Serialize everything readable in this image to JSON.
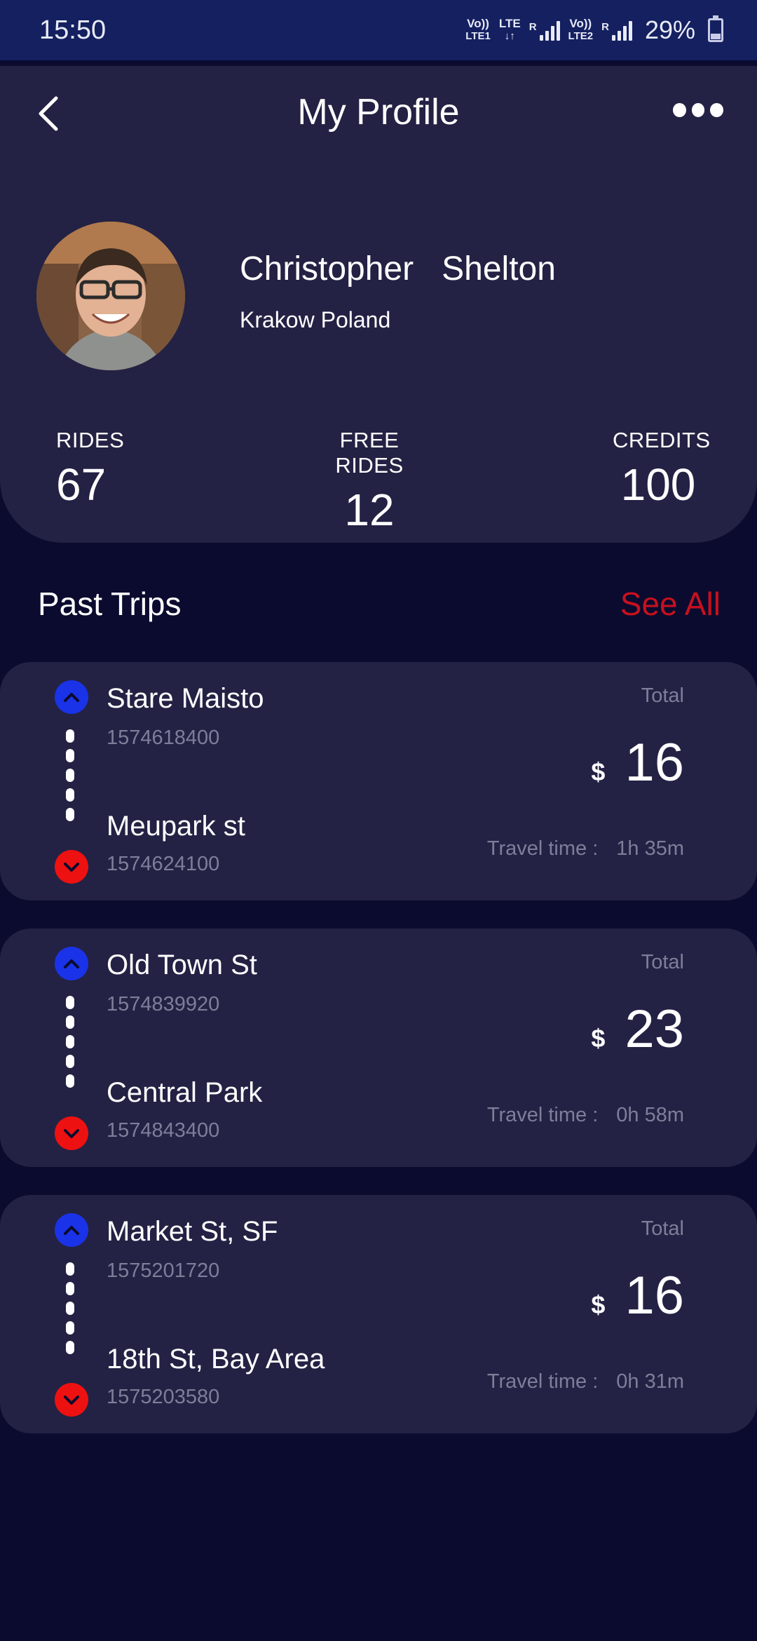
{
  "status_bar": {
    "time": "15:50",
    "net1_top": "Vo))",
    "net1_bottom": "LTE1",
    "net_mid_top": "LTE",
    "net_mid_bottom": "↓↑",
    "roaming_1": "R",
    "net2_top": "Vo))",
    "net2_bottom": "LTE2",
    "roaming_2": "R",
    "battery": "29%",
    "battery_level": 0.29
  },
  "header": {
    "title": "My Profile",
    "back_icon": "chevron-left-icon",
    "more_icon": "more-horizontal-icon"
  },
  "profile": {
    "first_name": "Christopher",
    "last_name": "Shelton",
    "city": "Krakow",
    "country": "Poland"
  },
  "stats": [
    {
      "label": "RIDES",
      "value": "67"
    },
    {
      "label": "FREE RIDES",
      "value": "12"
    },
    {
      "label": "CREDITS",
      "value": "100"
    }
  ],
  "past_trips": {
    "title": "Past Trips",
    "see_all": "See All",
    "total_label": "Total",
    "currency": "$",
    "travel_label": "Travel time :",
    "items": [
      {
        "from": "Stare Maisto",
        "from_time": "1574618400",
        "to": "Meupark st",
        "to_time": "1574624100",
        "total": "16",
        "travel_time": "1h 35m"
      },
      {
        "from": "Old Town St",
        "from_time": "1574839920",
        "to": "Central Park",
        "to_time": "1574843400",
        "total": "23",
        "travel_time": "0h 58m"
      },
      {
        "from": "Market St, SF",
        "from_time": "1575201720",
        "to": "18th St, Bay Area",
        "to_time": "1575203580",
        "total": "16",
        "travel_time": "0h 31m"
      }
    ]
  },
  "colors": {
    "background": "#0a0b2e",
    "card": "#232244",
    "status_bar": "#142060",
    "accent_red": "#c8101e",
    "start_blue": "#1a33e8",
    "end_red": "#ee1111"
  }
}
